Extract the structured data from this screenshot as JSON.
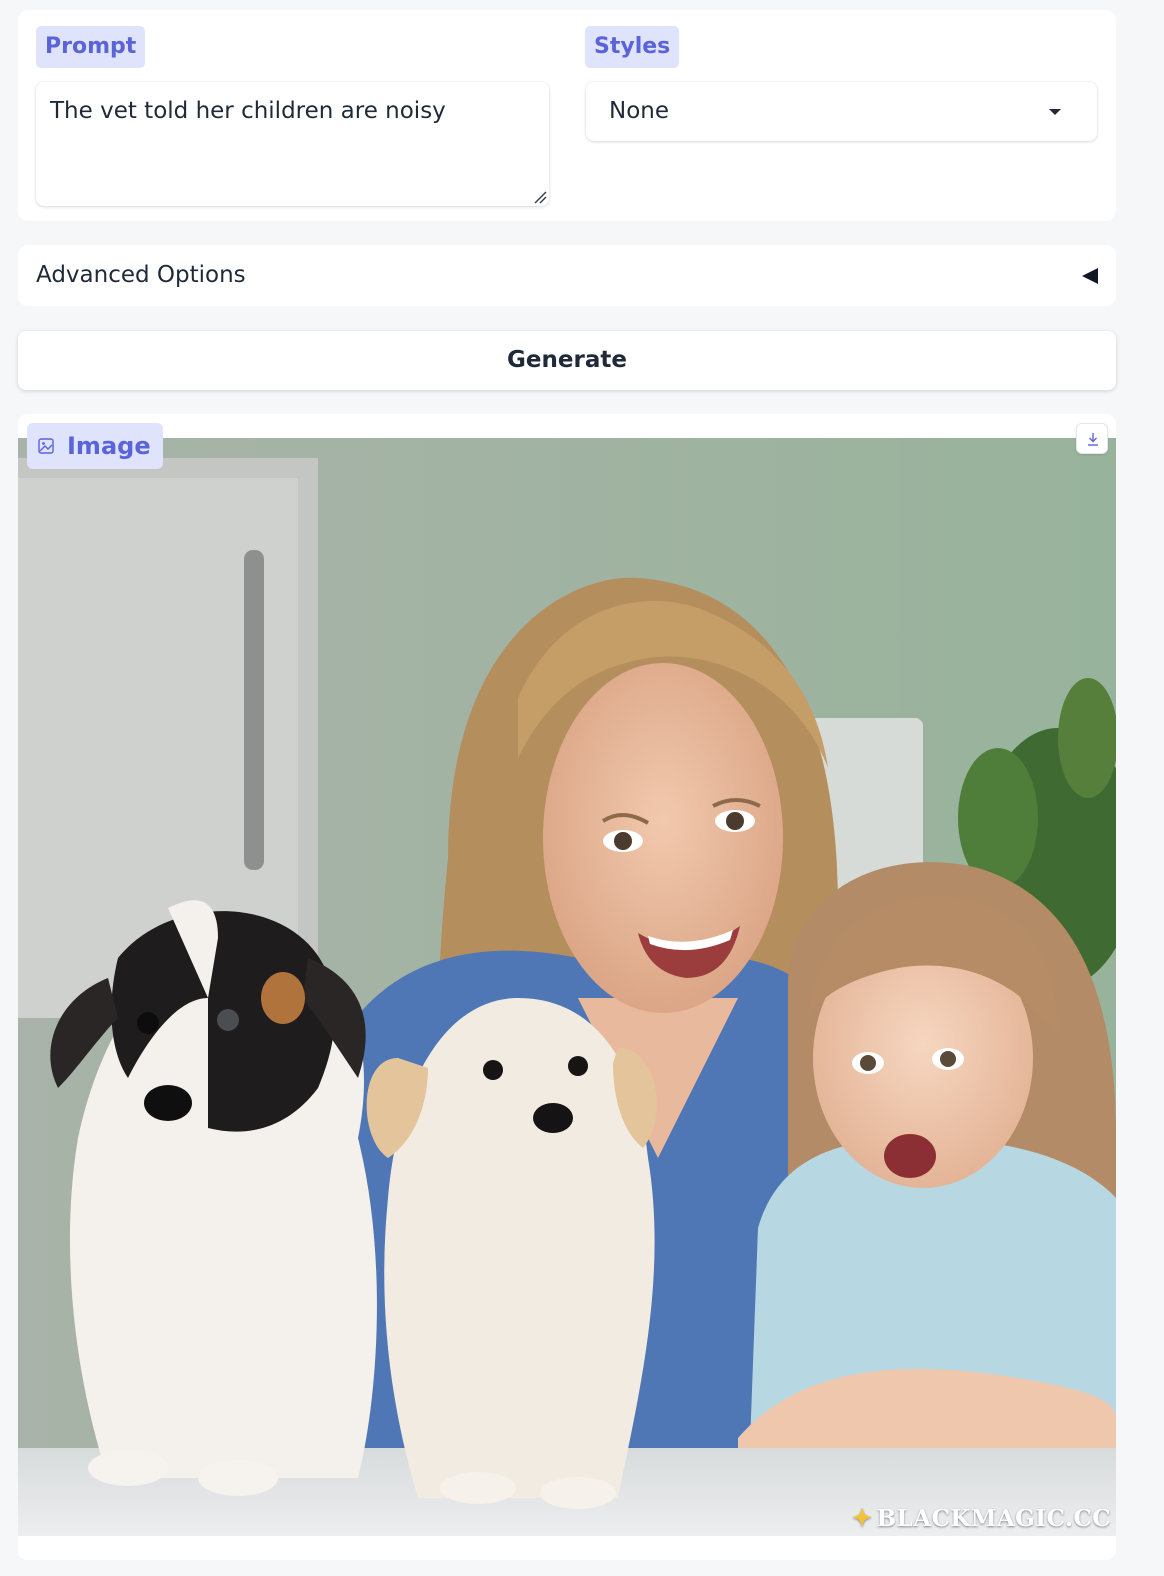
{
  "prompt": {
    "label": "Prompt",
    "value": "The vet told her children are noisy"
  },
  "styles": {
    "label": "Styles",
    "selected": "None"
  },
  "advanced": {
    "label": "Advanced Options"
  },
  "generate": {
    "label": "Generate"
  },
  "output": {
    "label": "Image",
    "watermark": "BLACKMAGIC.CC"
  },
  "colors": {
    "accent": "#5b63d9",
    "chip_bg": "#dfe3fb",
    "page_bg": "#f6f7f9"
  },
  "icons": [
    "image-icon",
    "download-icon",
    "caret-down-icon",
    "collapse-arrow-icon",
    "resize-grip-icon",
    "magic-wand-icon"
  ]
}
